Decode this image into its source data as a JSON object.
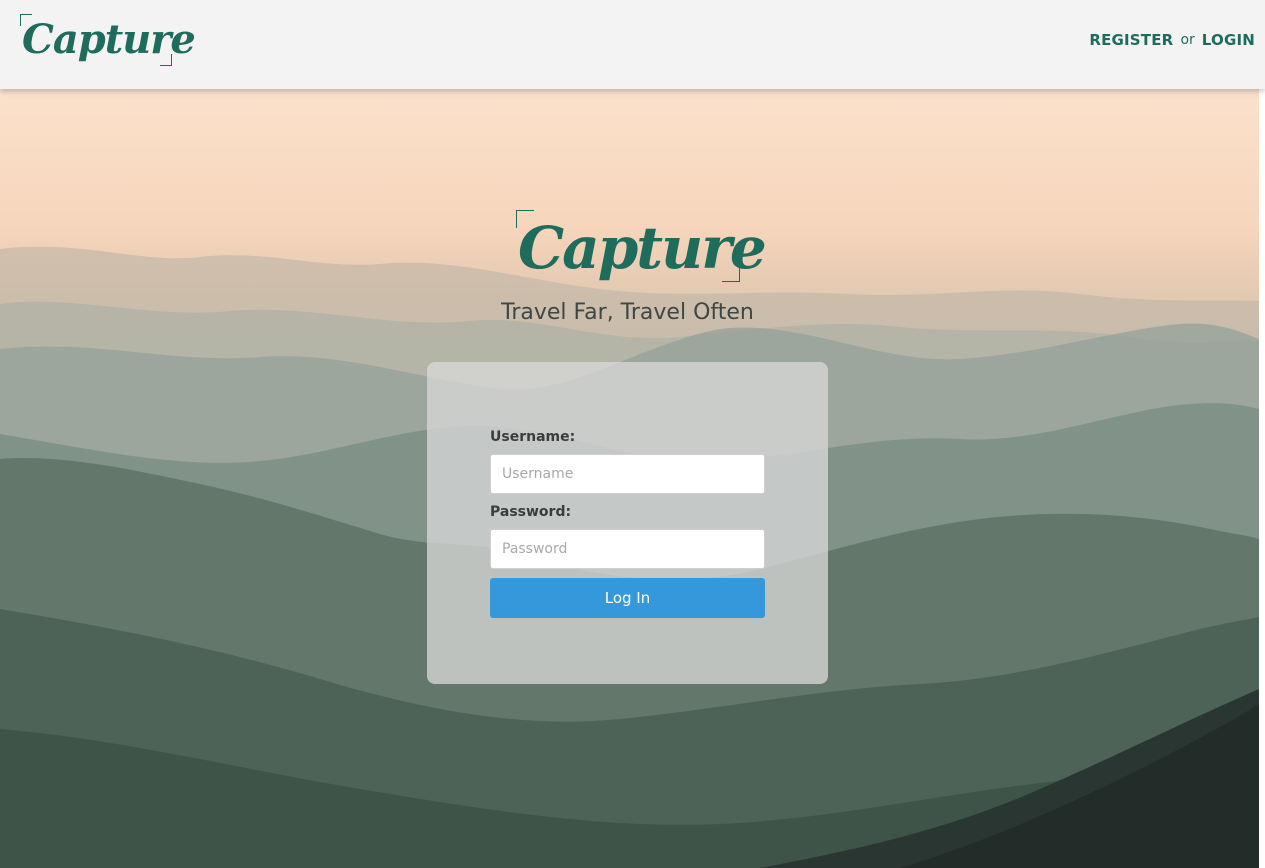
{
  "brand": {
    "name": "Capture",
    "tagline": "Travel Far, Travel Often",
    "color": "#1f6b5c"
  },
  "nav": {
    "register": "REGISTER",
    "separator": "or",
    "login": "LOGIN"
  },
  "login_form": {
    "username_label": "Username:",
    "username_placeholder": "Username",
    "password_label": "Password:",
    "password_placeholder": "Password",
    "submit_label": "Log In",
    "submit_color": "#3498db"
  }
}
